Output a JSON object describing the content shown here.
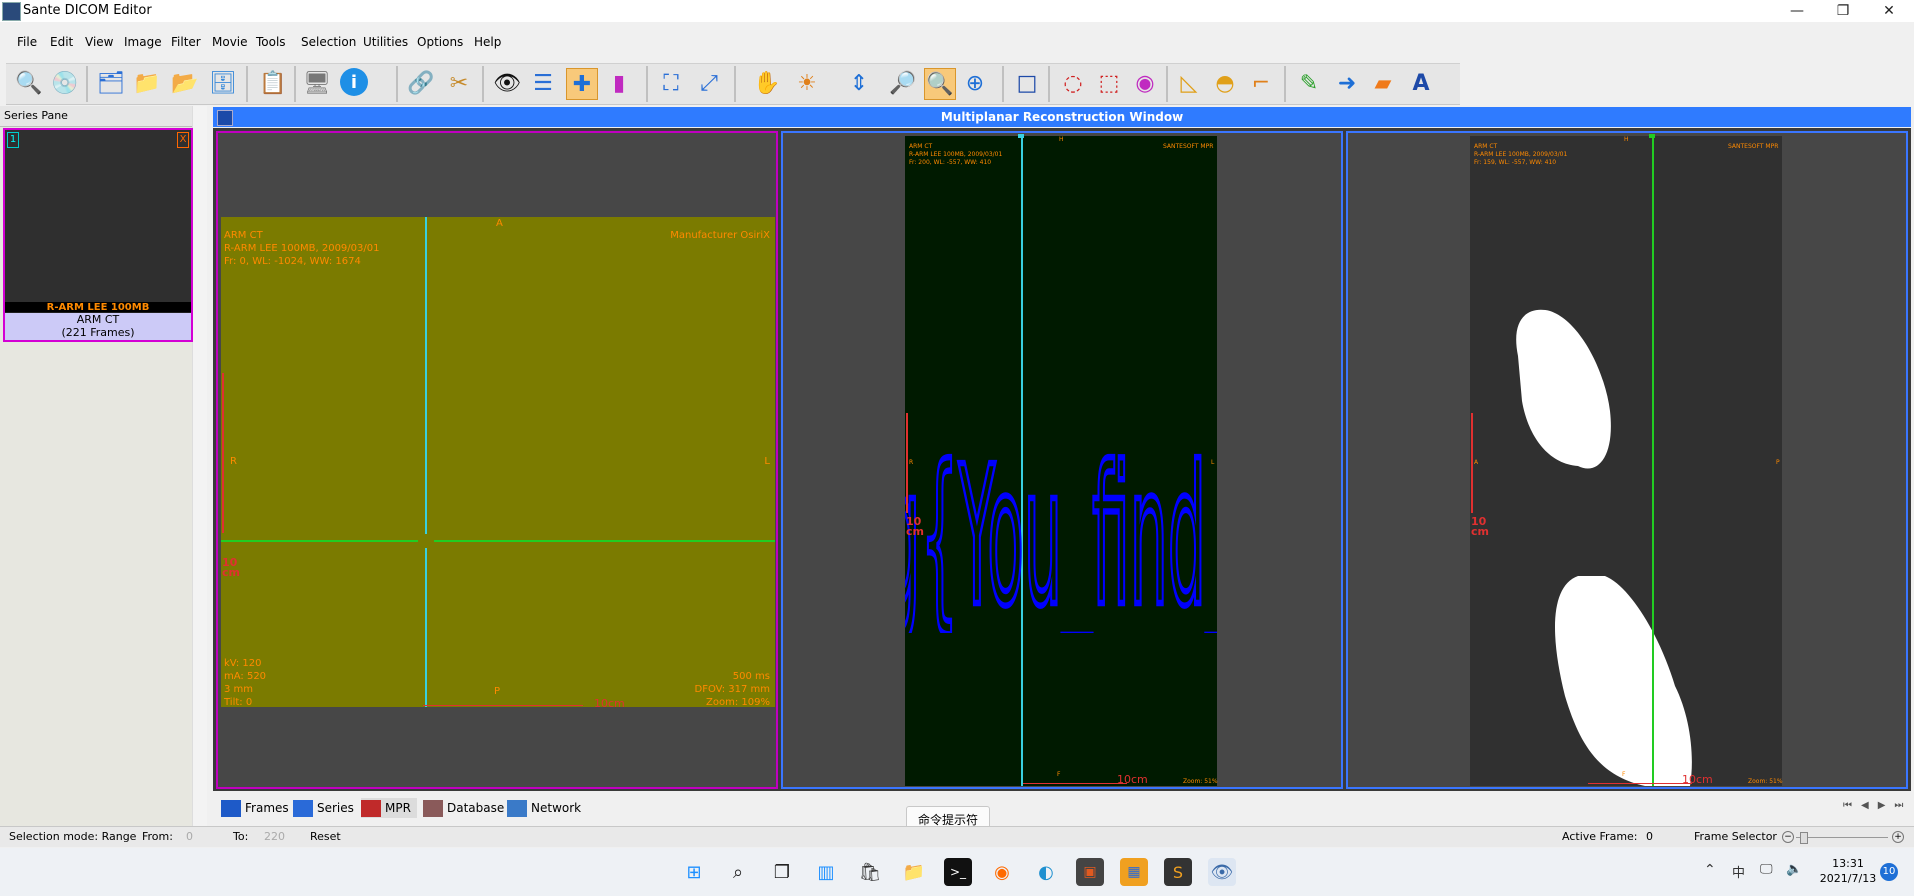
{
  "window": {
    "title": "Sante DICOM Editor",
    "minimize": "—",
    "maximize": "❐",
    "close": "✕"
  },
  "menu": [
    "File",
    "Edit",
    "View",
    "Image",
    "Filter",
    "Movie",
    "Tools",
    "Selection",
    "Utilities",
    "Options",
    "Help"
  ],
  "series_pane": {
    "header": "Series Pane",
    "thumb": {
      "index": "1",
      "close": "X",
      "name": "R-ARM LEE 100MB",
      "description": "ARM CT",
      "frames": "(221 Frames)"
    }
  },
  "mpr": {
    "title": "Multiplanar Reconstruction Window",
    "axial": {
      "line1": "ARM CT",
      "line2": "R-ARM LEE 100MB, 2009/03/01",
      "line3": "Fr: 0, WL: -1024, WW: 1674",
      "manufacturer": "Manufacturer OsiriX",
      "top": "A",
      "left": "R",
      "right": "L",
      "bottom": "P",
      "kv": "kV: 120",
      "ma": "mA: 520",
      "thickness": "3 mm",
      "tilt": "Tilt: 0",
      "time": "500 ms",
      "dfov": "DFOV: 317 mm",
      "zoom": "Zoom: 109%",
      "scale_h": "10cm",
      "scale_v1": "10",
      "scale_v2": "cm"
    },
    "coronal": {
      "line1": "ARM CT",
      "line2": "R-ARM LEE 100MB, 2009/03/01",
      "line3": "Fr: 200, WL: -557, WW: 410",
      "brand": "SANTESOFT MPR",
      "top": "H",
      "left": "R",
      "right": "L",
      "bottom": "F",
      "text": "flag{You_find_it}",
      "scale_h": "10cm",
      "scale_v1": "10",
      "scale_v2": "cm",
      "zoom": "Zoom: 51%"
    },
    "sagittal": {
      "line1": "ARM CT",
      "line2": "R-ARM LEE 100MB, 2009/03/01",
      "line3": "Fr: 159, WL: -557, WW: 410",
      "brand": "SANTESOFT MPR",
      "top": "H",
      "left": "A",
      "right": "P",
      "bottom": "F",
      "scale_h": "10cm",
      "scale_v1": "10",
      "scale_v2": "cm",
      "zoom": "Zoom: 51%"
    }
  },
  "tabs": [
    {
      "label": "Frames"
    },
    {
      "label": "Series"
    },
    {
      "label": "MPR"
    },
    {
      "label": "Database"
    },
    {
      "label": "Network"
    }
  ],
  "tooltip": "命令提示符",
  "status": {
    "selection_mode": "Selection mode: Range",
    "from_label": "From:",
    "from_value": "0",
    "to_label": "To:",
    "to_value": "220",
    "reset": "Reset",
    "active_frame_label": "Active Frame:",
    "active_frame_value": "0",
    "frame_selector": "Frame Selector"
  },
  "taskbar": {
    "ime": "中",
    "time": "13:31",
    "date": "2021/7/13",
    "notifications": "10"
  },
  "colors": {
    "accent": "#2f7bff",
    "axial_bg": "#7b7b00",
    "coronal_bg": "#001a00",
    "flag_text": "#0000ff",
    "overlay": "#ff8a00",
    "crosshair_cyan": "#39d0e0",
    "crosshair_green": "#22cc22"
  }
}
